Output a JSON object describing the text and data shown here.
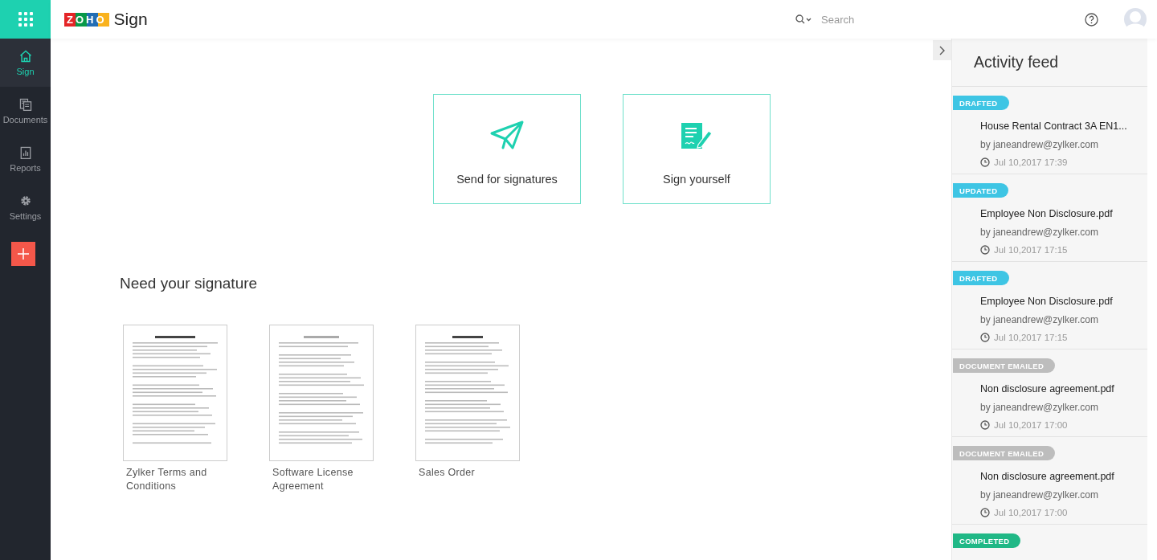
{
  "app": {
    "logo": "ZOHO",
    "product": "Sign"
  },
  "sidebar": {
    "items": [
      {
        "label": "Sign",
        "kind": "home",
        "selected": true
      },
      {
        "label": "Documents",
        "kind": "documents",
        "selected": false
      },
      {
        "label": "Reports",
        "kind": "reports",
        "selected": false
      },
      {
        "label": "Settings",
        "kind": "settings",
        "selected": false
      }
    ]
  },
  "search": {
    "placeholder": "Search"
  },
  "actions": [
    {
      "label": "Send for signatures",
      "kind": "send"
    },
    {
      "label": "Sign yourself",
      "kind": "sign"
    }
  ],
  "need_signature": {
    "title": "Need your signature",
    "documents": [
      {
        "name": "Zylker Terms and Conditions"
      },
      {
        "name": "Software License Agreement"
      },
      {
        "name": "Sales Order"
      }
    ]
  },
  "activity_feed": {
    "title": "Activity feed",
    "items": [
      {
        "status": "DRAFTED",
        "color": "#3ec5e4",
        "title": "House Rental Contract 3A EN1...",
        "author": "by janeandrew@zylker.com",
        "time": "Jul 10,2017 17:39"
      },
      {
        "status": "UPDATED",
        "color": "#3ec5e4",
        "title": "Employee Non Disclosure.pdf",
        "author": "by janeandrew@zylker.com",
        "time": "Jul 10,2017 17:15"
      },
      {
        "status": "DRAFTED",
        "color": "#3ec5e4",
        "title": "Employee Non Disclosure.pdf",
        "author": "by janeandrew@zylker.com",
        "time": "Jul 10,2017 17:15"
      },
      {
        "status": "DOCUMENT EMAILED",
        "color": "#bdbdbd",
        "title": "Non disclosure agreement.pdf",
        "author": "by janeandrew@zylker.com",
        "time": "Jul 10,2017 17:00"
      },
      {
        "status": "DOCUMENT EMAILED",
        "color": "#bdbdbd",
        "title": "Non disclosure agreement.pdf",
        "author": "by janeandrew@zylker.com",
        "time": "Jul 10,2017 17:00"
      },
      {
        "status": "COMPLETED",
        "color": "#20b886"
      }
    ]
  }
}
